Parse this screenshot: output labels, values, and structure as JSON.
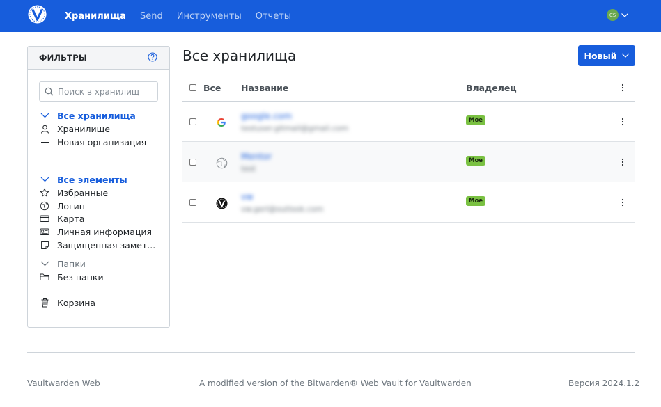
{
  "nav": {
    "links": [
      "Хранилища",
      "Send",
      "Инструменты",
      "Отчеты"
    ],
    "avatar_initials": "CS",
    "brand_color": "#175ddc"
  },
  "filters": {
    "title": "ФИЛЬТРЫ",
    "search_placeholder": "Поиск в хранилищ",
    "vaults_header": "Все хранилища",
    "vault_items": [
      "Хранилище",
      "Новая организация"
    ],
    "elements_header": "Все элементы",
    "element_items": [
      "Избранные",
      "Логин",
      "Карта",
      "Личная информация",
      "Защищенная замет..."
    ],
    "folders_header": "Папки",
    "folder_items": [
      "Без папки"
    ],
    "trash": "Корзина",
    "icons": {
      "vault_items": [
        "user-icon",
        "plus-icon"
      ],
      "element_items": [
        "star-icon",
        "globe-icon",
        "card-icon",
        "id-card-icon",
        "note-icon"
      ],
      "folder_items": [
        "folder-icon"
      ],
      "trash": "trash-icon"
    }
  },
  "main": {
    "title": "Все хранилища",
    "new_button": "Новый",
    "columns": {
      "all": "Все",
      "name": "Название",
      "owner": "Владелец"
    },
    "rows": [
      {
        "name": "google.com",
        "subtitle": "testuser.gitmail@gmail.com",
        "owner": "Мое",
        "icon": "google-icon"
      },
      {
        "name": "Mentor",
        "subtitle": "test",
        "owner": "Мое",
        "icon": "globe-icon"
      },
      {
        "name": "vw",
        "subtitle": "vw.gerl@outlook.com",
        "owner": "Мое",
        "icon": "vaultwarden-icon"
      }
    ],
    "owner_badge_color": "#7ac142"
  },
  "footer": {
    "left": "Vaultwarden Web",
    "center": "A modified version of the Bitwarden® Web Vault for Vaultwarden",
    "right": "Версия 2024.1.2"
  }
}
